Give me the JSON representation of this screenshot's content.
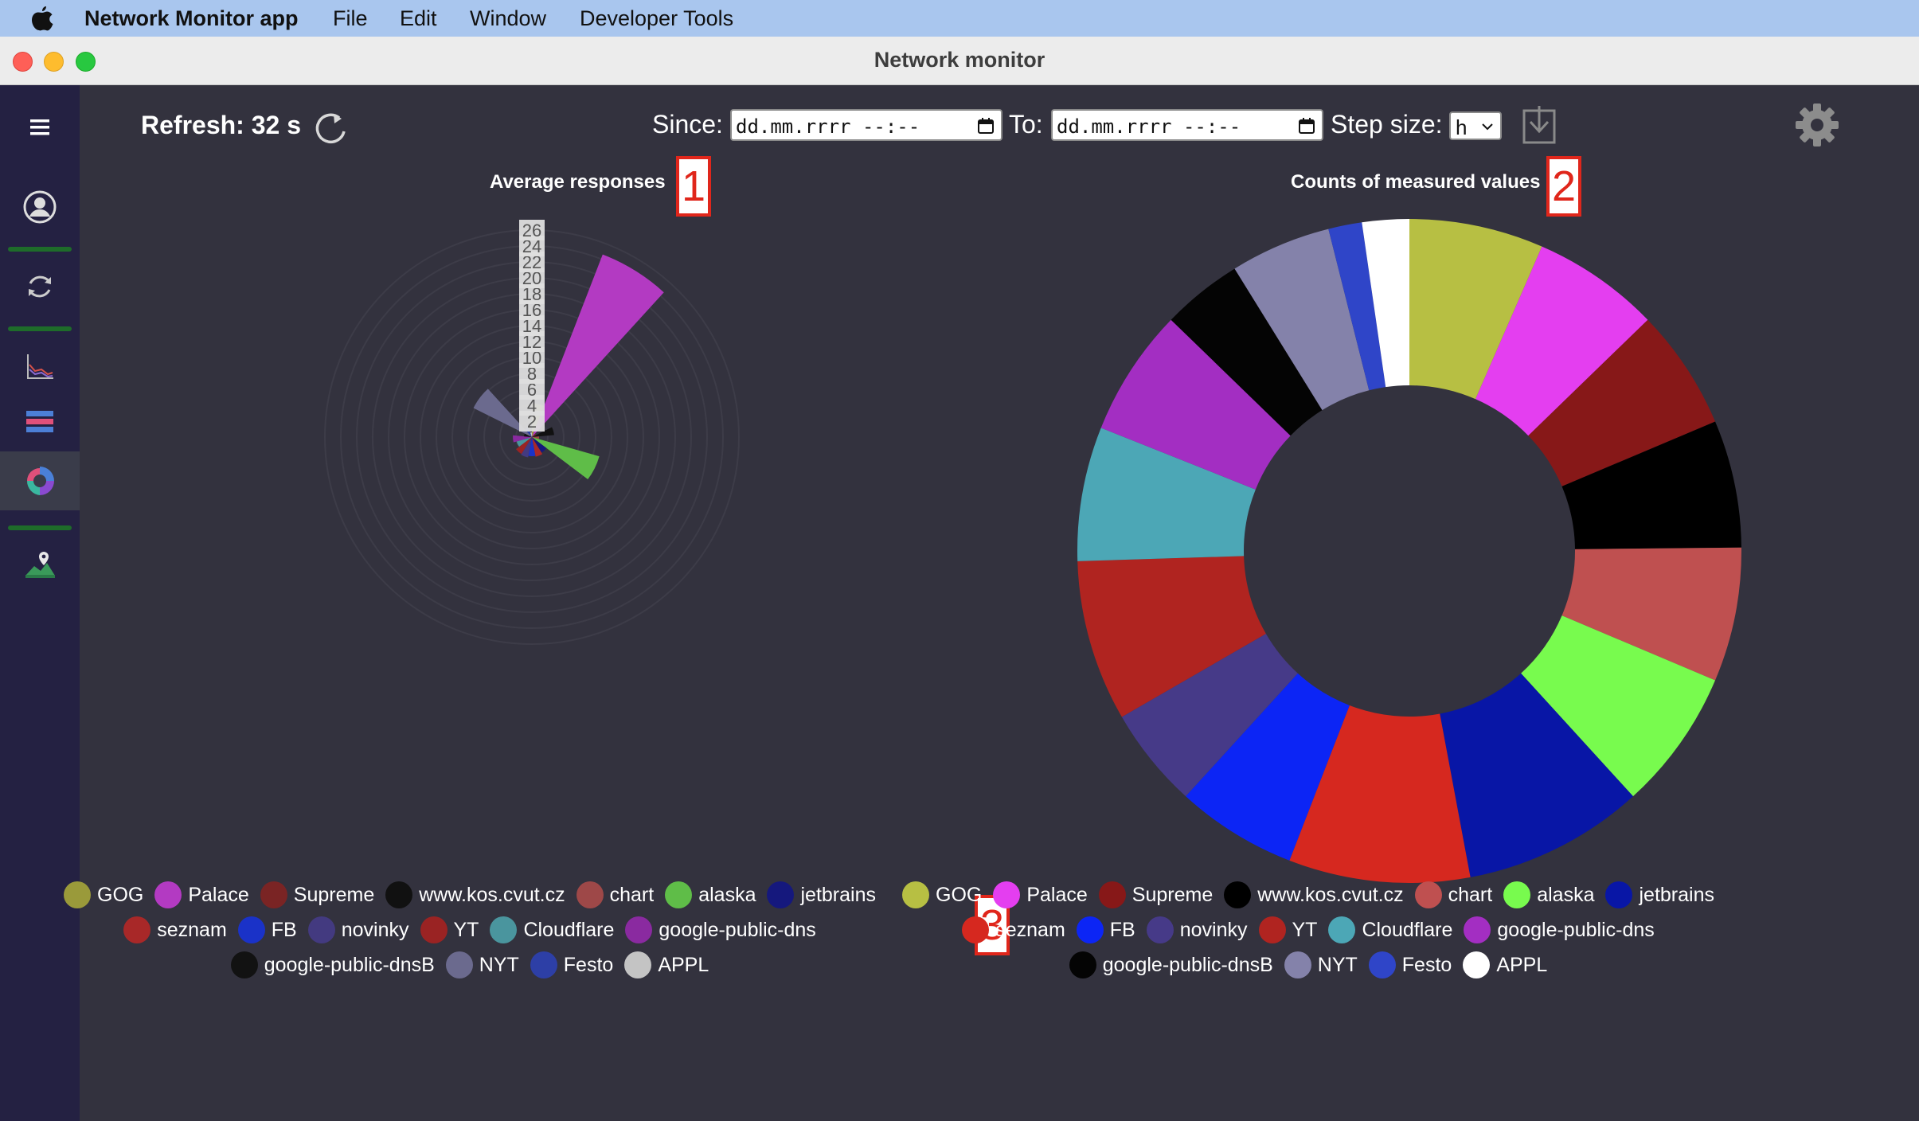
{
  "menubar": {
    "app_name": "Network Monitor app",
    "items": [
      "File",
      "Edit",
      "Window",
      "Developer Tools"
    ]
  },
  "window": {
    "title": "Network monitor"
  },
  "sidebar": {
    "items": [
      "menu",
      "user-account",
      "refresh",
      "line-chart",
      "bar-chart",
      "polar-chart",
      "map"
    ],
    "active": "polar-chart",
    "separator_color": "#1e6c2a"
  },
  "toolbar": {
    "refresh_label": "Refresh: 32 s",
    "since_label": "Since:",
    "since_value": "dd.mm.rrrr --:--",
    "to_label": "To:",
    "to_value": "dd.mm.rrrr --:--",
    "step_label": "Step size:",
    "step_value": "h"
  },
  "badges": [
    "1",
    "2",
    "3"
  ],
  "chart_data": [
    {
      "type": "polarArea",
      "title": "Average responses",
      "r_ticks": [
        "2",
        "4",
        "6",
        "8",
        "10",
        "12",
        "14",
        "16",
        "18",
        "20",
        "22",
        "24",
        "26"
      ],
      "r_max": 26,
      "grid": true,
      "legend_position": "bottom",
      "categories": [
        "GOG",
        "Palace",
        "Supreme",
        "www.kos.cvut.cz",
        "chart",
        "alaska",
        "jetbrains",
        "seznam",
        "FB",
        "novinky",
        "YT",
        "Cloudflare",
        "google-public-dns",
        "google-public-dnsB",
        "NYT",
        "Festo",
        "APPL"
      ],
      "colors": [
        "#9a9a3a",
        "#b33ac2",
        "#7a2424",
        "#111111",
        "#9e4848",
        "#5fbd48",
        "#15187d",
        "#a82828",
        "#1a32c8",
        "#433a80",
        "#9a2323",
        "#4a959e",
        "#8a2aa0",
        "#121212",
        "#6b6a8e",
        "#2d3fa6",
        "#c4c4c4"
      ],
      "values": [
        4.2,
        24.6,
        0.6,
        2.8,
        0.9,
        8.8,
        2.3,
        2.5,
        2.4,
        2.6,
        2.5,
        2.0,
        2.4,
        1.0,
        8.2,
        1.3,
        0.6
      ]
    },
    {
      "type": "doughnut",
      "title": "Counts of measured values",
      "legend_position": "bottom",
      "categories": [
        "GOG",
        "Palace",
        "Supreme",
        "www.kos.cvut.cz",
        "chart",
        "alaska",
        "jetbrains",
        "seznam",
        "FB",
        "novinky",
        "YT",
        "Cloudflare",
        "google-public-dns",
        "google-public-dnsB",
        "NYT",
        "Festo",
        "APPL"
      ],
      "colors": [
        "#b7bf43",
        "#e43ef0",
        "#871818",
        "#000000",
        "#bf5050",
        "#78fb4e",
        "#0816a6",
        "#d6281f",
        "#0c25f5",
        "#463a88",
        "#b02420",
        "#4ca7b6",
        "#a32ec2",
        "#040404",
        "#8482aa",
        "#2f45c8",
        "#ffffff"
      ],
      "values": [
        20,
        19,
        18,
        19,
        20,
        21,
        27,
        27,
        18,
        15,
        24,
        20,
        19,
        12,
        15,
        5,
        7
      ]
    }
  ]
}
